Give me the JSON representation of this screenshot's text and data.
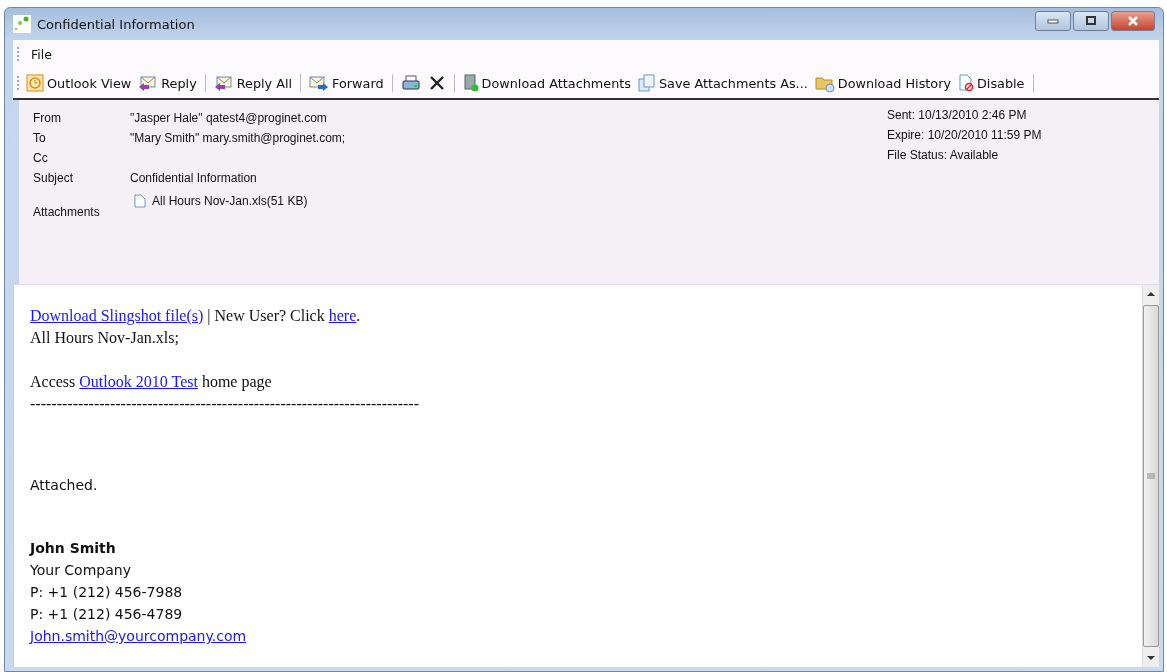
{
  "window": {
    "title": "Confidential Information"
  },
  "menu": [
    "File"
  ],
  "toolbar": [
    {
      "kind": "clock",
      "label": "Outlook View"
    },
    {
      "kind": "reply",
      "label": "Reply"
    },
    {
      "kind": "separator"
    },
    {
      "kind": "reply",
      "label": "Reply All"
    },
    {
      "kind": "separator"
    },
    {
      "kind": "forward",
      "label": "Forward"
    },
    {
      "kind": "separator"
    },
    {
      "kind": "print"
    },
    {
      "kind": "delete"
    },
    {
      "kind": "separator"
    },
    {
      "kind": "download",
      "label": "Download Attachments"
    },
    {
      "kind": "save",
      "label": "Save Attachments As..."
    },
    {
      "kind": "history",
      "label": "Download History"
    },
    {
      "kind": "disable",
      "label": "Disable"
    },
    {
      "kind": "separator"
    }
  ],
  "header": {
    "fields": [
      {
        "label": "From",
        "value": "\"Jasper Hale\" qatest4@proginet.com"
      },
      {
        "label": "To",
        "value": "\"Mary  Smith\"  mary.smith@proginet.com;"
      },
      {
        "label": "Cc"
      },
      {
        "label": "Subject",
        "value": "Confidential Information"
      },
      {
        "label": "Attachments",
        "attachment": "All Hours Nov-Jan.xls(51 KB)"
      }
    ],
    "info": [
      "Sent:  10/13/2010 2:46 PM",
      "Expire: 10/20/2010 11:59 PM",
      "File Status: Available"
    ]
  },
  "body": {
    "paragraphs": [
      [
        {
          "parts": [
            {
              "kind": "link",
              "text": "Download Slingshot file(s)"
            },
            {
              "kind": "text",
              "text": " | New User? Click "
            },
            {
              "kind": "link",
              "text": "here"
            },
            {
              "kind": "text",
              "text": "."
            }
          ]
        },
        {
          "parts": [
            {
              "kind": "text",
              "text": "All Hours Nov-Jan.xls;"
            }
          ]
        }
      ],
      [
        {
          "parts": [
            {
              "kind": "text",
              "text": "Access "
            },
            {
              "kind": "link",
              "text": "Outlook 2010 Test"
            },
            {
              "kind": "text",
              "text": " home page"
            }
          ]
        },
        {
          "parts": [
            {
              "kind": "text",
              "text": "-------------------------------------------------------------------------"
            }
          ]
        }
      ]
    ],
    "message": "Attached.",
    "signature": {
      "name": "John Smith",
      "lines": [
        "Your Company",
        "P: +1 (212) 456-7988",
        "P: +1 (212) 456-4789"
      ],
      "email": "John.smith@yourcompany.com"
    }
  }
}
